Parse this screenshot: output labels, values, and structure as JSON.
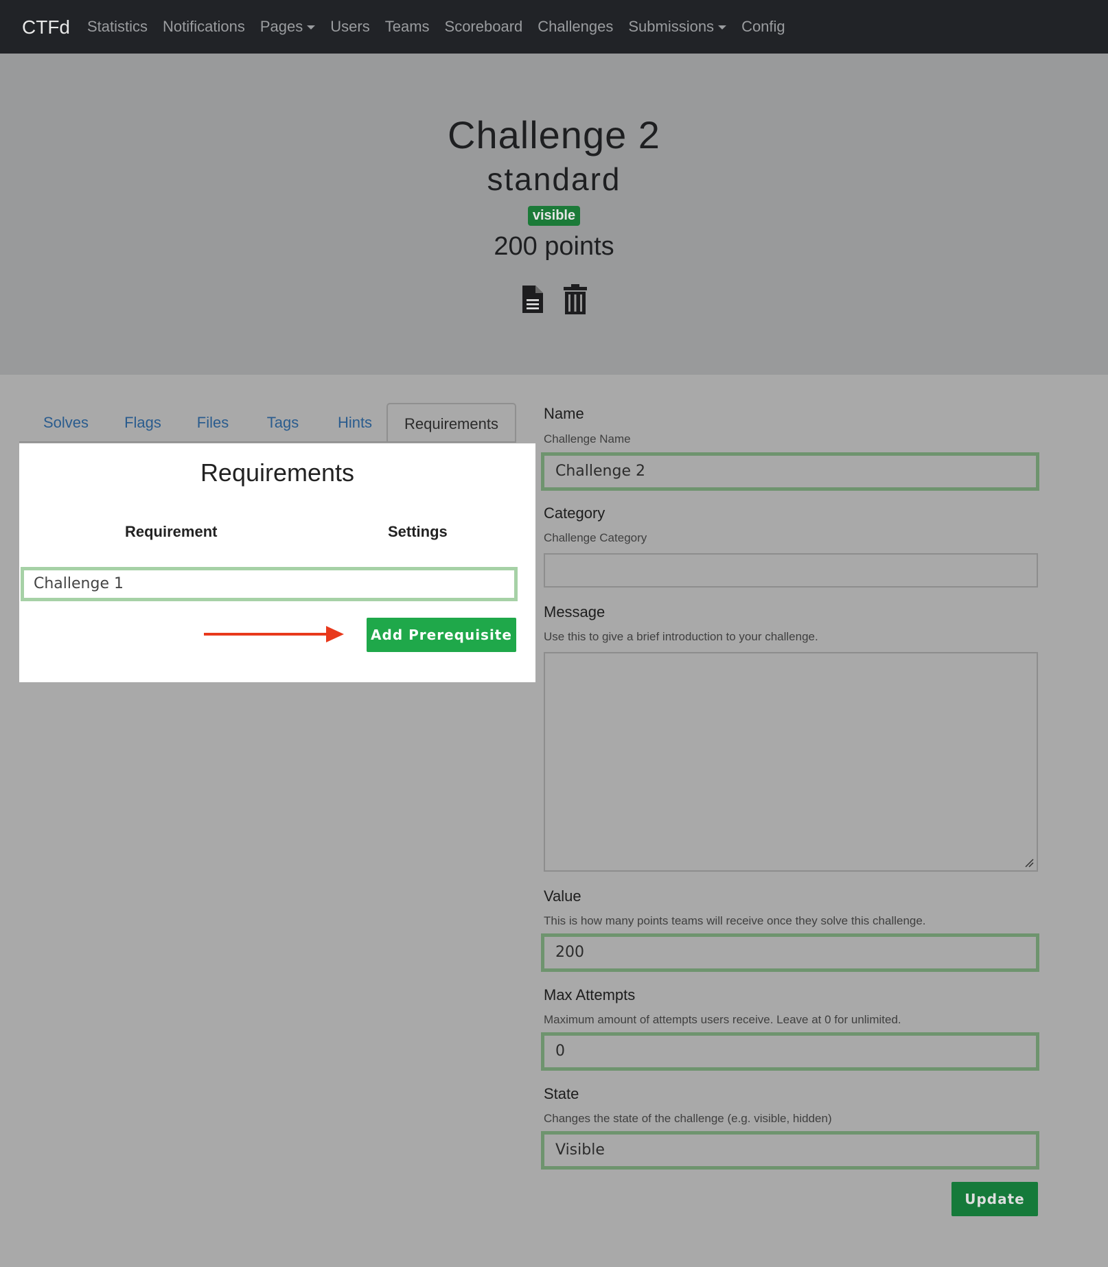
{
  "navbar": {
    "brand": "CTFd",
    "links": [
      {
        "label": "Statistics",
        "dropdown": false
      },
      {
        "label": "Notifications",
        "dropdown": false
      },
      {
        "label": "Pages",
        "dropdown": true
      },
      {
        "label": "Users",
        "dropdown": false
      },
      {
        "label": "Teams",
        "dropdown": false
      },
      {
        "label": "Scoreboard",
        "dropdown": false
      },
      {
        "label": "Challenges",
        "dropdown": false
      },
      {
        "label": "Submissions",
        "dropdown": true
      },
      {
        "label": "Config",
        "dropdown": false
      }
    ]
  },
  "challenge": {
    "name": "Challenge 2",
    "type": "standard",
    "state_badge": "visible",
    "points": "200 points",
    "icons": [
      "document-icon",
      "trash-icon"
    ]
  },
  "tabs": [
    {
      "label": "Solves",
      "active": false
    },
    {
      "label": "Flags",
      "active": false
    },
    {
      "label": "Files",
      "active": false
    },
    {
      "label": "Tags",
      "active": false
    },
    {
      "label": "Hints",
      "active": false
    },
    {
      "label": "Requirements",
      "active": true
    }
  ],
  "requirements": {
    "title": "Requirements",
    "col_requirement": "Requirement",
    "col_settings": "Settings",
    "selected": "Challenge 1",
    "add_button": "Add Prerequisite"
  },
  "form": {
    "name": {
      "label": "Name",
      "help": "Challenge Name",
      "value": "Challenge 2"
    },
    "category": {
      "label": "Category",
      "help": "Challenge Category",
      "value": ""
    },
    "message": {
      "label": "Message",
      "help": "Use this to give a brief introduction to your challenge.",
      "value": ""
    },
    "value": {
      "label": "Value",
      "help": "This is how many points teams will receive once they solve this challenge.",
      "value": "200"
    },
    "max_attempts": {
      "label": "Max Attempts",
      "help": "Maximum amount of attempts users receive. Leave at 0 for unlimited.",
      "value": "0"
    },
    "state": {
      "label": "State",
      "help": "Changes the state of the challenge (e.g. visible, hidden)",
      "value": "Visible"
    },
    "update_button": "Update"
  },
  "colors": {
    "navbar_bg": "#212327",
    "accent_green": "#1fa84a",
    "arrow_red": "#e8391c",
    "link_blue": "#2a5c8e"
  }
}
